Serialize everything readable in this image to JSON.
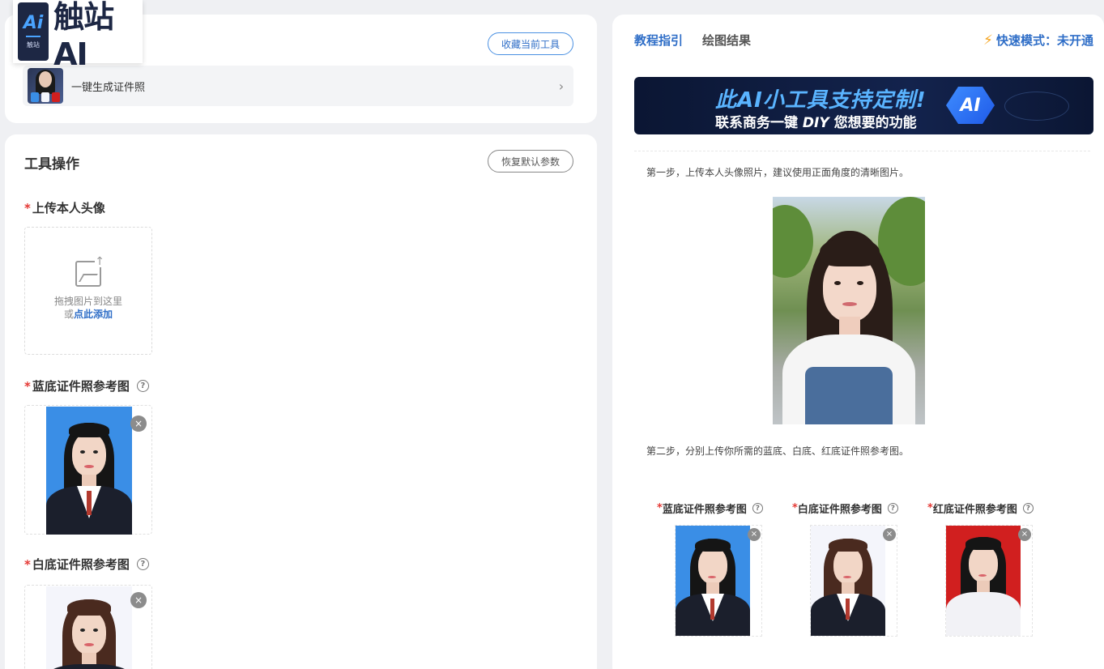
{
  "logo": {
    "badge_text": "Ai",
    "badge_sub": "触站",
    "brand": "触站AI"
  },
  "top_card": {
    "favorite_button": "收藏当前工具",
    "tool_name": "一键生成证件照",
    "chevron": "›"
  },
  "tool_panel": {
    "title": "工具操作",
    "reset_button": "恢复默认参数",
    "upload_label": "上传本人头像",
    "upload_hint_line1": "拖拽图片到这里",
    "upload_hint_prefix": "或",
    "upload_hint_link": "点此添加",
    "blue_label": "蓝底证件照参考图",
    "white_label": "白底证件照参考图",
    "required_mark": "*",
    "help_mark": "?",
    "close_mark": "×"
  },
  "right_panel": {
    "tab_guide": "教程指引",
    "tab_result": "绘图结果",
    "fast_mode": "快速模式：未开通",
    "bolt_icon": "⚡",
    "banner_title": "此AI小工具支持定制!",
    "banner_sub_prefix": "联系商务一键 ",
    "banner_sub_bold": "DIY",
    "banner_sub_suffix": " 您想要的功能",
    "banner_logo": "AI",
    "step1": "第一步，上传本人头像照片，建议使用正面角度的清晰图片。",
    "step2": "第二步，分别上传你所需的蓝底、白底、红底证件照参考图。",
    "ref_blue": "蓝底证件照参考图",
    "ref_white": "白底证件照参考图",
    "ref_red": "红底证件照参考图"
  },
  "colors": {
    "accent": "#2f6ec7",
    "required": "#e53935",
    "blue_bg": "#3a8ee6",
    "red_bg": "#d11f1f",
    "white_bg": "#f4f5fb"
  }
}
